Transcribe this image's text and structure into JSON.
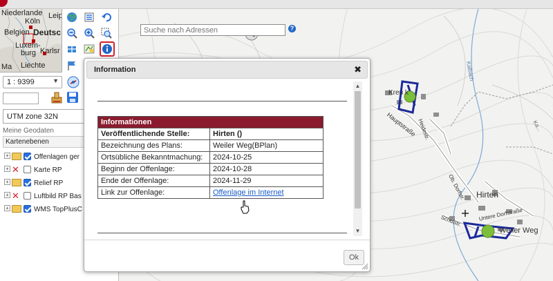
{
  "overview_map": {
    "labels": [
      "Niederlande",
      "Leipz",
      "Köln",
      "Belgien",
      "Deutsc",
      "Luxem-",
      "burg",
      "Karlsr",
      "Liechte",
      "Ma"
    ]
  },
  "left_panel": {
    "scale_value": "1 : 9399",
    "crs_value": "UTM zone 32N",
    "geodata_heading": "Meine Geodaten",
    "tab_label": "Kartenebenen",
    "layers": [
      {
        "label": "Offenlagen ger",
        "state": "checked"
      },
      {
        "label": "Karte RP",
        "state": "unchecked"
      },
      {
        "label": "Relief RP",
        "state": "checked"
      },
      {
        "label": "Luftbild RP Bas",
        "state": "unchecked"
      },
      {
        "label": "WMS TopPlusC",
        "state": "checked"
      }
    ]
  },
  "search": {
    "placeholder": "Suche nach Adressen"
  },
  "map_labels": {
    "kreuzeck": "Kreu  k",
    "hauptstrasse": "Hauptstraße",
    "heidestr": "Heidestr.",
    "obdorfstr": "Ob. Dorfstr.",
    "hirten": "Hirten",
    "schulstr": "Schulstr.",
    "untere_dorfstrasse": "Untere Dorfstraße",
    "weiler_weg": "Weiler Weg",
    "kalbach": "Kalbach",
    "muehle": "Ka..."
  },
  "dialog": {
    "title": "Information",
    "table_header": "Informationen",
    "rows": [
      {
        "key": "Veröffentlichende Stelle:",
        "value": "Hirten ()",
        "bold": true
      },
      {
        "key": "Bezeichnung des Plans:",
        "value": "Weiler Weg(BPlan)"
      },
      {
        "key": "Ortsübliche Bekanntmachung:",
        "value": "2024-10-25"
      },
      {
        "key": "Beginn der Offenlage:",
        "value": "2024-10-28"
      },
      {
        "key": "Ende der Offenlage:",
        "value": "2024-11-29"
      },
      {
        "key": "Link zur Offenlage:",
        "value": "Offenlage im Internet",
        "link": true
      }
    ],
    "ok_label": "Ok"
  },
  "colors": {
    "table_header_bg": "#8a1b2e",
    "link": "#1a5bc4",
    "plan_outline": "#1a2a9a",
    "plan_marker": "#7cbf3a",
    "selected_tool_border": "#d4202a"
  },
  "icons": [
    "globe-icon",
    "layer-list-icon",
    "back-arrow-icon",
    "zoom-out-icon",
    "zoom-in-icon",
    "zoom-box-icon",
    "pan-icon",
    "pan-map-icon",
    "info-icon",
    "stamp-icon",
    "save-icon",
    "search-icon",
    "help-icon",
    "close-icon",
    "map-pin-icon"
  ]
}
